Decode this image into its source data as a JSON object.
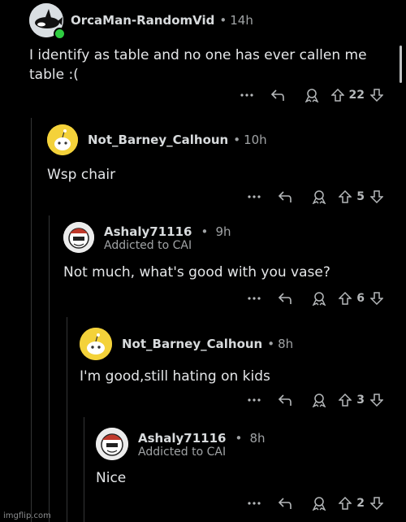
{
  "comments": [
    {
      "author": "OrcaMan-RandomVid",
      "time": "14h",
      "body": "I identify as table and no one has ever callen me table :(",
      "score": "22"
    },
    {
      "author": "Not_Barney_Calhoun",
      "time": "10h",
      "body": "Wsp chair",
      "score": "5"
    },
    {
      "author": "Ashaly71116",
      "time": "9h",
      "flair": "Addicted to CAI",
      "body": "Not much, what's good with you vase?",
      "score": "6"
    },
    {
      "author": "Not_Barney_Calhoun",
      "time": "8h",
      "body": "I'm good,still hating on kids",
      "score": "3"
    },
    {
      "author": "Ashaly71116",
      "time": "8h",
      "flair": "Addicted to CAI",
      "body": "Nice",
      "score": "2"
    }
  ],
  "separator": "•",
  "watermark": "imgflip.com",
  "icons": {
    "more": "more-options-icon",
    "reply": "reply-icon",
    "award": "award-icon",
    "upvote": "upvote-icon",
    "downvote": "downvote-icon"
  },
  "colors": {
    "background": "#000000",
    "text": "#d7dadc",
    "muted": "#a0a3a5",
    "online": "#2ecc40",
    "snoo_bg": "#f4d23a"
  }
}
